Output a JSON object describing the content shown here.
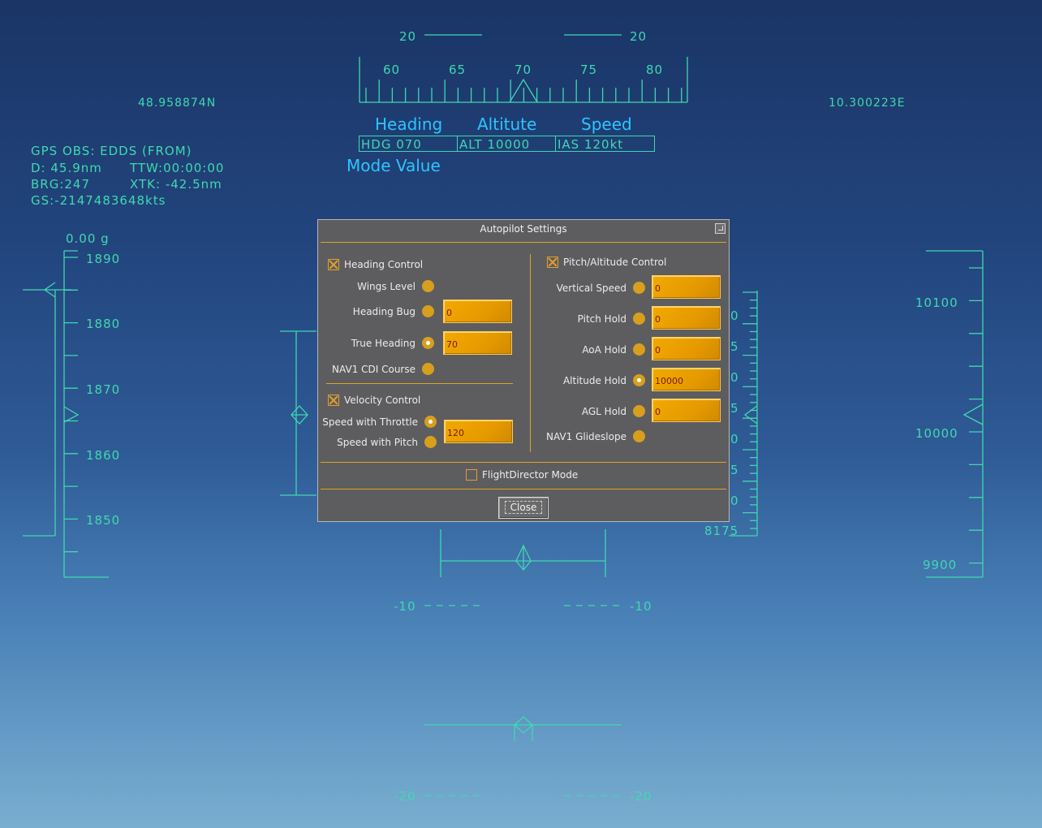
{
  "hud": {
    "pitch_top_left": "20",
    "pitch_top_right": "20",
    "heading_ticks": [
      "60",
      "65",
      "70",
      "75",
      "80"
    ],
    "lat": "48.958874N",
    "lon": "10.300223E",
    "mode_labels": {
      "heading": "Heading",
      "altitude": "Altitute",
      "speed": "Speed"
    },
    "mode_values": {
      "heading": "HDG 070",
      "altitude": "ALT 10000",
      "speed": "IAS 120kt"
    },
    "mode_value_caption": "Mode Value",
    "gps": {
      "line1": "GPS OBS: EDDS  (FROM)",
      "distance": "D: 45.9nm",
      "ttw": "TTW:00:00:00",
      "brg": "BRG:247",
      "xtk": "XTK: -42.5nm",
      "gs": "GS:-2147483648kts"
    },
    "g_load": "0.00 g",
    "speed_ticks": [
      "1890",
      "1880",
      "1870",
      "1860",
      "1850"
    ],
    "alt_ticks": [
      "10100",
      "10000",
      "9900"
    ],
    "vsi_value": "8175",
    "vsi_partial": [
      "0",
      "5",
      "0",
      "5",
      "0",
      "5",
      "0"
    ],
    "pitch_m10_left": "-10",
    "pitch_m10_right": "-10",
    "pitch_m20_left": "-20",
    "pitch_m20_right": "-20"
  },
  "dialog": {
    "title": "Autopilot Settings",
    "heading_section": {
      "label": "Heading Control",
      "checked": true,
      "rows": [
        {
          "label": "Wings Level",
          "selected": false,
          "value": null
        },
        {
          "label": "Heading Bug",
          "selected": false,
          "value": "0"
        },
        {
          "label": "True Heading",
          "selected": true,
          "value": "70"
        },
        {
          "label": "NAV1 CDI Course",
          "selected": false,
          "value": null
        }
      ]
    },
    "velocity_section": {
      "label": "Velocity Control",
      "checked": true,
      "rows": [
        {
          "label": "Speed with Throttle",
          "selected": true
        },
        {
          "label": "Speed with Pitch",
          "selected": false
        }
      ],
      "value": "120"
    },
    "pitch_section": {
      "label": "Pitch/Altitude Control",
      "checked": true,
      "rows": [
        {
          "label": "Vertical Speed",
          "selected": false,
          "value": "0"
        },
        {
          "label": "Pitch Hold",
          "selected": false,
          "value": "0"
        },
        {
          "label": "AoA Hold",
          "selected": false,
          "value": "0"
        },
        {
          "label": "Altitude Hold",
          "selected": true,
          "value": "10000"
        },
        {
          "label": "AGL Hold",
          "selected": false,
          "value": "0"
        },
        {
          "label": "NAV1 Glideslope",
          "selected": false,
          "value": null
        }
      ]
    },
    "flight_director": {
      "label": "FlightDirector Mode",
      "checked": false
    },
    "close_label": "Close"
  },
  "colors": {
    "hud_green": "#40d8b0",
    "hud_blue": "#2ec4ff",
    "accent_orange": "#e69a00",
    "dialog_bg": "#5d5d60"
  }
}
